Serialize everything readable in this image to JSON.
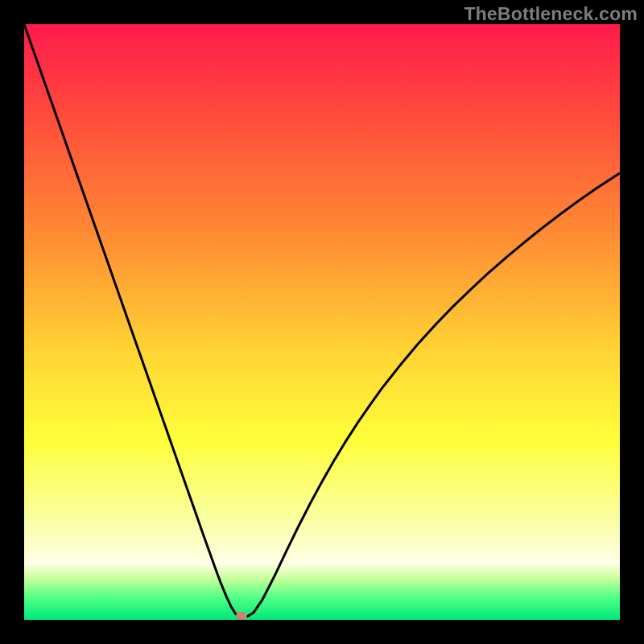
{
  "watermark": "TheBottleneck.com",
  "chart_data": {
    "type": "line",
    "title": "",
    "xlabel": "",
    "ylabel": "",
    "xlim": [
      0,
      100
    ],
    "ylim": [
      0,
      100
    ],
    "grid": false,
    "legend": false,
    "background": {
      "stops": [
        {
          "offset": 0.0,
          "color": "#ff1a4c"
        },
        {
          "offset": 0.15,
          "color": "#ff4a3c"
        },
        {
          "offset": 0.35,
          "color": "#ff8a33"
        },
        {
          "offset": 0.55,
          "color": "#ffd433"
        },
        {
          "offset": 0.7,
          "color": "#ffff3a"
        },
        {
          "offset": 0.83,
          "color": "#faffa0"
        },
        {
          "offset": 0.905,
          "color": "#ffffe6"
        },
        {
          "offset": 0.93,
          "color": "#c8ff9a"
        },
        {
          "offset": 0.965,
          "color": "#49ff85"
        },
        {
          "offset": 1.0,
          "color": "#00e878"
        }
      ]
    },
    "marker": {
      "x": 36.5,
      "y": 0.7,
      "color": "#cf806f"
    },
    "series": [
      {
        "name": "curve",
        "color": "#000000",
        "stroke_width": 3,
        "x": [
          0,
          2,
          4,
          6,
          8,
          10,
          12,
          14,
          16,
          18,
          20,
          22,
          24,
          26,
          28,
          30,
          31,
          32,
          33,
          34,
          34.8,
          35.5,
          36.5,
          37.5,
          38.5,
          40,
          42,
          44,
          46,
          48,
          50,
          52,
          54,
          56,
          58,
          60,
          63,
          66,
          69,
          72,
          75,
          78,
          81,
          84,
          87,
          90,
          93,
          96,
          100
        ],
        "y": [
          100,
          94.3,
          88.6,
          82.9,
          77.2,
          71.5,
          65.8,
          60.1,
          54.4,
          48.7,
          43.0,
          37.3,
          31.6,
          25.9,
          20.2,
          14.5,
          11.7,
          8.9,
          6.2,
          3.8,
          2.1,
          1.0,
          0.6,
          0.6,
          1.2,
          3.4,
          7.3,
          11.5,
          15.6,
          19.5,
          23.2,
          26.7,
          30.0,
          33.1,
          36.0,
          38.8,
          42.6,
          46.2,
          49.5,
          52.6,
          55.5,
          58.3,
          60.9,
          63.4,
          65.8,
          68.1,
          70.3,
          72.4,
          75.0
        ]
      }
    ]
  }
}
